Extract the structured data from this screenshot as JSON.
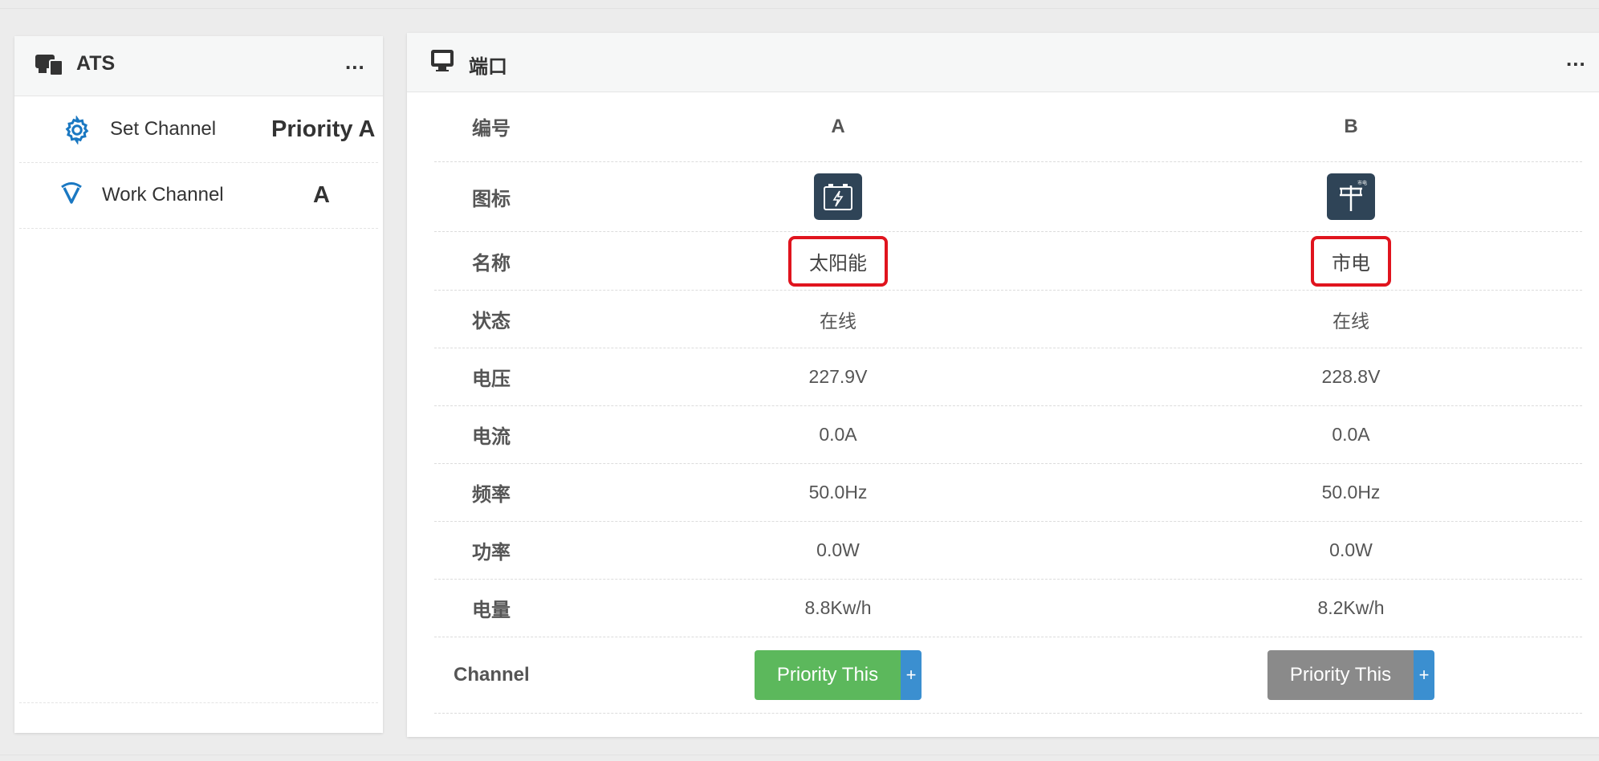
{
  "ats_panel": {
    "title": "ATS",
    "more": "...",
    "rows": [
      {
        "icon": "gear-icon",
        "label": "Set Channel",
        "value": "Priority A"
      },
      {
        "icon": "signal-icon",
        "label": "Work Channel",
        "value": "A"
      }
    ]
  },
  "port_panel": {
    "title": "端口",
    "more": "...",
    "header": {
      "label": "编号",
      "a": "A",
      "b": "B"
    },
    "icon_row": {
      "label": "图标",
      "a_icon": "battery-solar-icon",
      "b_icon": "power-pole-icon",
      "b_icon_text": "市电"
    },
    "name_row": {
      "label": "名称",
      "a": "太阳能",
      "b": "市电"
    },
    "rows": [
      {
        "label": "状态",
        "a": "在线",
        "b": "在线"
      },
      {
        "label": "电压",
        "a": "227.9V",
        "b": "228.8V"
      },
      {
        "label": "电流",
        "a": "0.0A",
        "b": "0.0A"
      },
      {
        "label": "频率",
        "a": "50.0Hz",
        "b": "50.0Hz"
      },
      {
        "label": "功率",
        "a": "0.0W",
        "b": "0.0W"
      },
      {
        "label": "电量",
        "a": "8.8Kw/h",
        "b": "8.2Kw/h"
      }
    ],
    "channel_row": {
      "label": "Channel",
      "a_button": "Priority This",
      "b_button": "Priority This",
      "plus": "+"
    }
  },
  "colors": {
    "active_button": "#5cb85c",
    "inactive_button": "#8a8a8a",
    "plus_button": "#3b8fd0",
    "highlight_box": "#e0141e",
    "icon_bg": "#2f4457",
    "accent_icon": "#1a78c2"
  }
}
